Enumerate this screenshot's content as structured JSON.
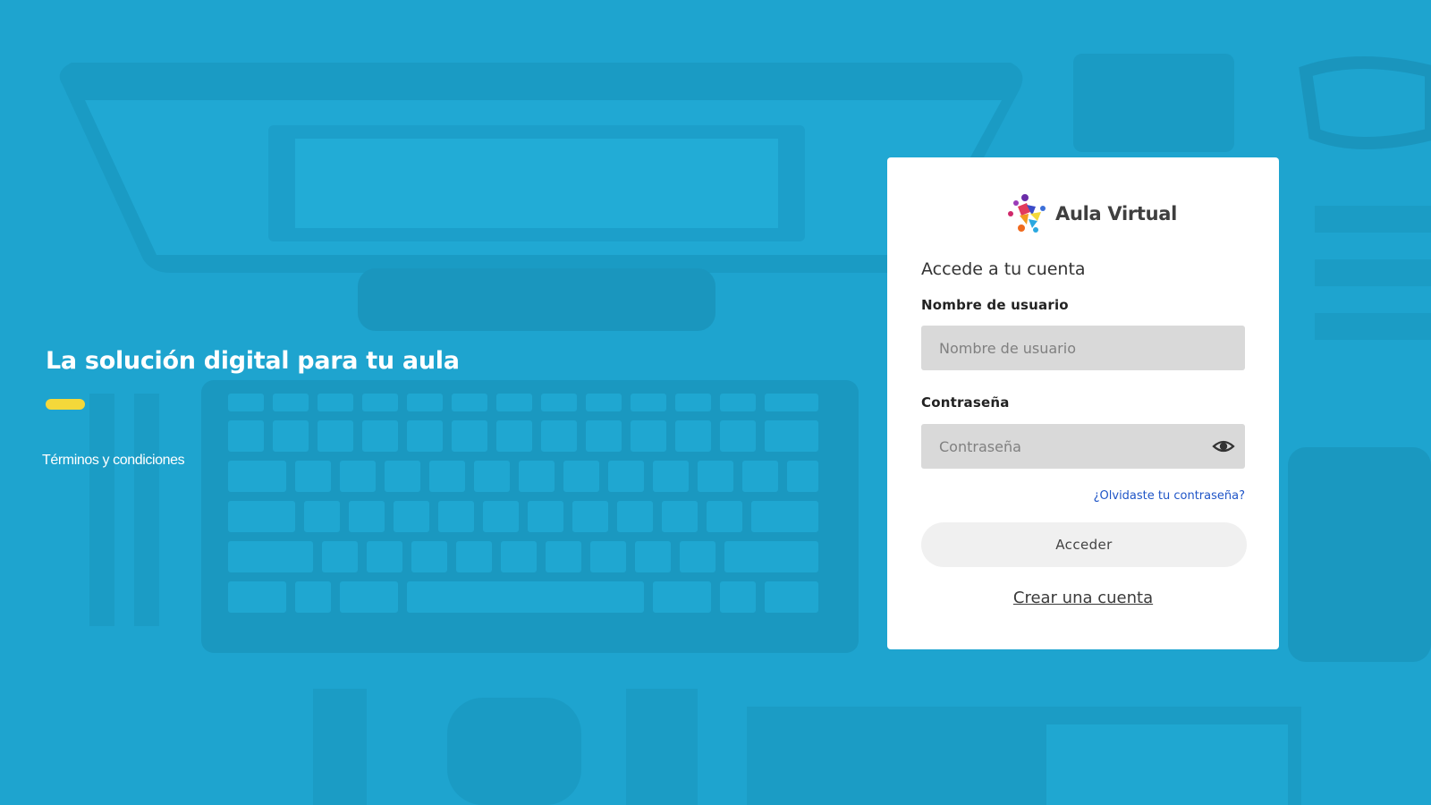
{
  "hero": {
    "title": "La solución digital para tu aula",
    "terms_link": "Términos y condiciones",
    "accent_color": "#f4d83a"
  },
  "login_card": {
    "brand_name": "Aula Virtual",
    "heading": "Accede a tu cuenta",
    "username": {
      "label": "Nombre de usuario",
      "placeholder": "Nombre de usuario",
      "value": ""
    },
    "password": {
      "label": "Contraseña",
      "placeholder": "Contraseña",
      "value": "",
      "toggle_icon": "eye-icon"
    },
    "forgot_link": "¿Olvidaste tu contraseña?",
    "submit_label": "Acceder",
    "create_account_link": "Crear una cuenta"
  },
  "colors": {
    "background": "#1ea4cf",
    "link": "#1f55c7"
  }
}
